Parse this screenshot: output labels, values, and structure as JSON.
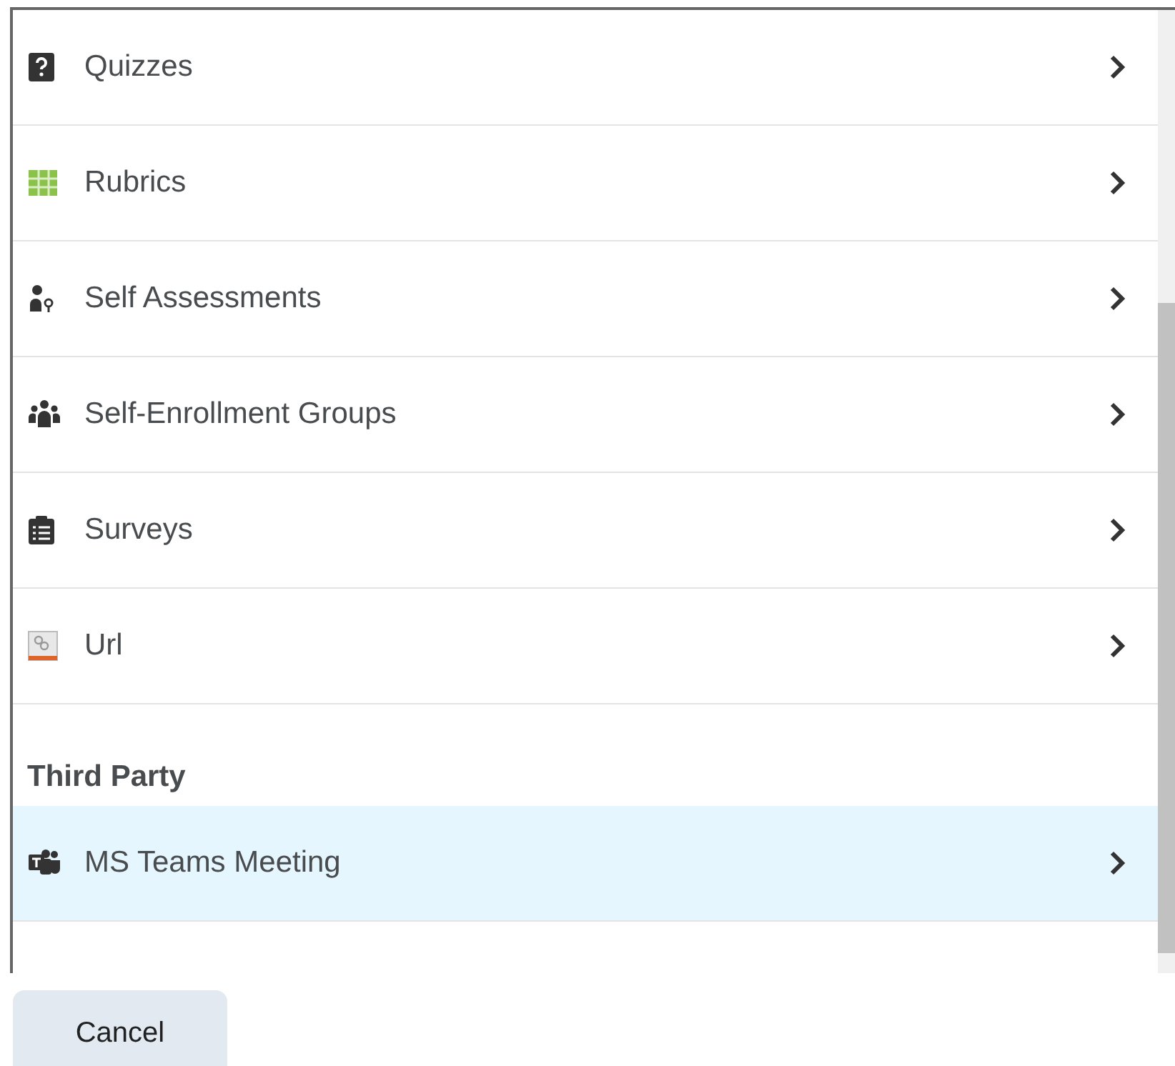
{
  "items": [
    {
      "label": "Quizzes",
      "kind": "quiz",
      "selected": false
    },
    {
      "label": "Rubrics",
      "kind": "rubric",
      "selected": false
    },
    {
      "label": "Self Assessments",
      "kind": "self",
      "selected": false
    },
    {
      "label": "Self-Enrollment Groups",
      "kind": "groups",
      "selected": false
    },
    {
      "label": "Surveys",
      "kind": "survey",
      "selected": false
    },
    {
      "label": "Url",
      "kind": "url",
      "selected": false
    }
  ],
  "section": {
    "title": "Third Party",
    "items": [
      {
        "label": "MS Teams Meeting",
        "kind": "teams",
        "selected": true
      }
    ]
  },
  "cancel_button": "Cancel"
}
